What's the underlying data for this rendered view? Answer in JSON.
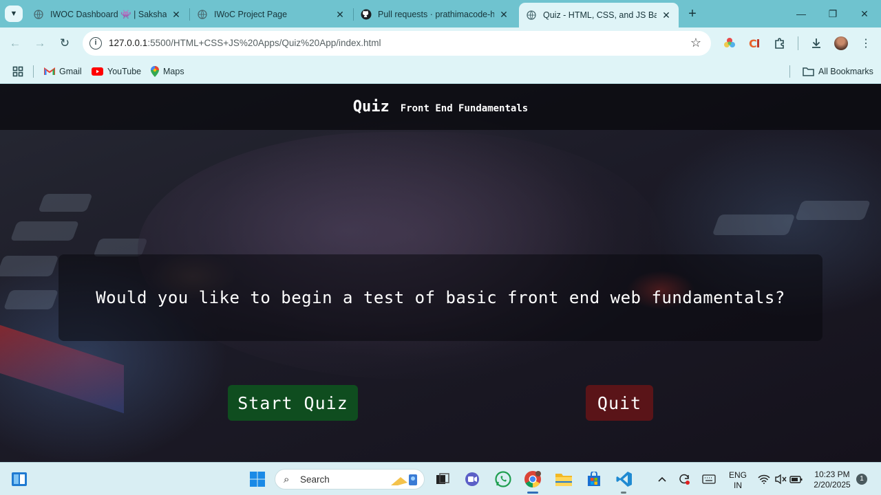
{
  "browser": {
    "tabs": [
      {
        "title": "IWOC Dashboard 👾 | Saksham",
        "icon": "globe-icon",
        "active": false
      },
      {
        "title": "IWoC Project Page",
        "icon": "globe-icon",
        "active": false
      },
      {
        "title": "Pull requests · prathimacode-hub",
        "icon": "github-icon",
        "active": false
      },
      {
        "title": "Quiz - HTML, CSS, and JS Basics",
        "icon": "globe-icon",
        "active": true
      }
    ],
    "address": {
      "host": "127.0.0.1",
      "path": ":5500/HTML+CSS+JS%20Apps/Quiz%20App/index.html"
    },
    "bookmarks": [
      {
        "label": "Gmail",
        "icon": "gmail-icon"
      },
      {
        "label": "YouTube",
        "icon": "youtube-icon"
      },
      {
        "label": "Maps",
        "icon": "maps-icon"
      }
    ],
    "all_bookmarks_label": "All Bookmarks"
  },
  "page": {
    "title": "Quiz",
    "subtitle": "Front End Fundamentals",
    "question": "Would you like to begin a test of basic front end web fundamentals?",
    "start_button": "Start Quiz",
    "quit_button": "Quit"
  },
  "taskbar": {
    "search_placeholder": "Search",
    "language_line1": "ENG",
    "language_line2": "IN",
    "time": "10:23 PM",
    "date": "2/20/2025",
    "notification_count": "1"
  },
  "colors": {
    "start_button_bg": "#0f4d1f",
    "quit_button_bg": "#5a1418",
    "header_bg": "#08080c",
    "browser_frame": "#6fc3cf"
  }
}
